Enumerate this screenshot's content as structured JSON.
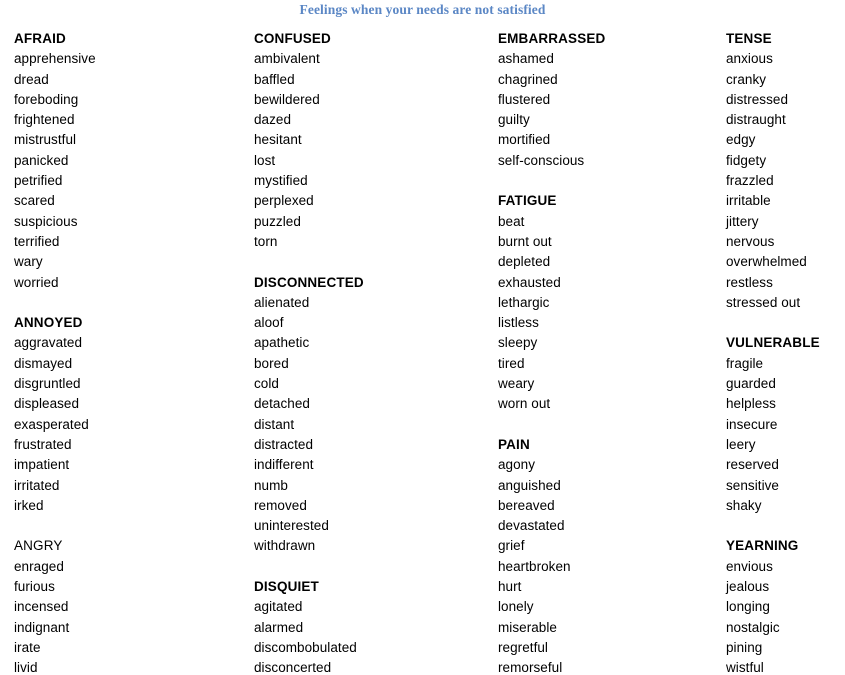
{
  "document": {
    "title": "Feelings when your needs are not satisfied",
    "title_color": "#5B87C5",
    "text_color": "#000000",
    "background_color": "#ffffff"
  },
  "columns": [
    {
      "sections": [
        {
          "heading": "AFRAID",
          "heading_bold": true,
          "words": [
            "apprehensive",
            "dread",
            "foreboding",
            "frightened",
            "mistrustful",
            "panicked",
            "petrified",
            "scared",
            "suspicious",
            "terrified",
            "wary",
            "worried"
          ]
        },
        {
          "heading": "ANNOYED",
          "heading_bold": true,
          "words": [
            "aggravated",
            "dismayed",
            "disgruntled",
            "displeased",
            "exasperated",
            "frustrated",
            "impatient",
            "irritated",
            "irked"
          ]
        },
        {
          "heading": "ANGRY",
          "heading_bold": false,
          "words": [
            "enraged",
            "furious",
            "incensed",
            "indignant",
            "irate",
            "livid"
          ]
        }
      ]
    },
    {
      "sections": [
        {
          "heading": "CONFUSED",
          "heading_bold": true,
          "words": [
            "ambivalent",
            "baffled",
            "bewildered",
            "dazed",
            "hesitant",
            "lost",
            "mystified",
            "perplexed",
            "puzzled",
            "torn"
          ]
        },
        {
          "heading": "DISCONNECTED",
          "heading_bold": true,
          "words": [
            "alienated",
            "aloof",
            "apathetic",
            "bored",
            "cold",
            "detached",
            "distant",
            "distracted",
            "indifferent",
            "numb",
            "removed",
            "uninterested",
            "withdrawn"
          ]
        },
        {
          "heading": "DISQUIET",
          "heading_bold": true,
          "words": [
            "agitated",
            "alarmed",
            "discombobulated",
            "disconcerted"
          ]
        }
      ]
    },
    {
      "sections": [
        {
          "heading": "EMBARRASSED",
          "heading_bold": true,
          "words": [
            "ashamed",
            "chagrined",
            "flustered",
            "guilty",
            "mortified",
            "self-conscious"
          ]
        },
        {
          "heading": "FATIGUE",
          "heading_bold": true,
          "words": [
            "beat",
            "burnt out",
            "depleted",
            "exhausted",
            "lethargic",
            "listless",
            "sleepy",
            "tired",
            "weary",
            "worn out"
          ]
        },
        {
          "heading": "PAIN",
          "heading_bold": true,
          "words": [
            "agony",
            "anguished",
            "bereaved",
            "devastated",
            "grief",
            "heartbroken",
            "hurt",
            "lonely",
            "miserable",
            "regretful",
            "remorseful"
          ]
        }
      ]
    },
    {
      "sections": [
        {
          "heading": "TENSE",
          "heading_bold": true,
          "words": [
            "anxious",
            "cranky",
            "distressed",
            "distraught",
            "edgy",
            "fidgety",
            "frazzled",
            "irritable",
            "jittery",
            "nervous",
            "overwhelmed",
            "restless",
            "stressed out"
          ]
        },
        {
          "heading": "VULNERABLE",
          "heading_bold": true,
          "words": [
            "fragile",
            "guarded",
            "helpless",
            "insecure",
            "leery",
            "reserved",
            "sensitive",
            "shaky"
          ]
        },
        {
          "heading": "YEARNING",
          "heading_bold": true,
          "words": [
            "envious",
            "jealous",
            "longing",
            "nostalgic",
            "pining",
            "wistful"
          ]
        }
      ]
    }
  ]
}
